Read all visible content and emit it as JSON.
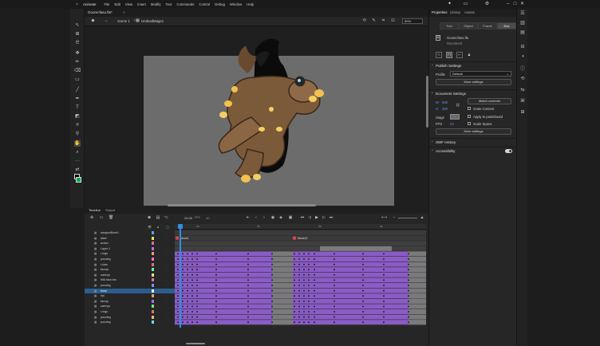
{
  "app": {
    "name": "Animate",
    "menus": [
      "File",
      "Edit",
      "View",
      "Insert",
      "Modify",
      "Text",
      "Commands",
      "Control",
      "Debug",
      "Window",
      "Help"
    ]
  },
  "document": {
    "tab_title": "Goomcfaso.fla*",
    "scene": "Scene 1",
    "symbol": "UndeadMage1",
    "zoom": "50%"
  },
  "properties": {
    "tabs": [
      "Properties",
      "Library",
      "Assets"
    ],
    "mode_tabs": [
      "Tool",
      "Object",
      "Frame",
      "Doc"
    ],
    "active_mode": "Doc",
    "doc_name": "Goomcfaso.fla",
    "doc_type": "Document",
    "publish_settings": {
      "title": "Publish Settings",
      "profile_label": "Profile",
      "profile_value": "Default",
      "more_label": "More settings"
    },
    "document_settings": {
      "title": "Document Settings",
      "w_label": "W",
      "w_value": "550",
      "h_label": "H",
      "h_value": "400",
      "match_label": "Match contents",
      "scale_content": "Scale Content",
      "apply_pasteboard": "Apply to pasteboard",
      "stage_label": "Stage",
      "fps_label": "FPS",
      "fps_value": "24",
      "scale_spans": "Scale Spans",
      "more_label": "More settings"
    },
    "swf_history": "SWF History",
    "accessibility": "Accessibility"
  },
  "timeline": {
    "tabs": [
      "Timeline",
      "Output"
    ],
    "fps": "24.00",
    "fps_unit": "FPS",
    "frame": "40",
    "ruler_ticks": [
      "1s",
      "2s",
      "3s",
      "4s"
    ],
    "frame_labels": [
      "Move1",
      "Move12"
    ],
    "layers": [
      {
        "name": "weaponBone1",
        "color": "#5aa0e6",
        "selected": false
      },
      {
        "name": "label",
        "color": "#e1e35a",
        "selected": false
      },
      {
        "name": "action",
        "color": "#e86f8f",
        "selected": false
      },
      {
        "name": "Layer 1",
        "color": "#b06fe8",
        "selected": false
      },
      {
        "name": "r-legs",
        "color": "#e8a05a",
        "selected": false
      },
      {
        "name": "pocoleg",
        "color": "#e86fd0",
        "selected": false
      },
      {
        "name": "r-kaw",
        "color": "#e86f6f",
        "selected": false
      },
      {
        "name": "facrup",
        "color": "#6fe8c0",
        "selected": false
      },
      {
        "name": "uarrnys",
        "color": "#e8e06f",
        "selected": false
      },
      {
        "name": "Wid face-fns",
        "color": "#e86fa0",
        "selected": false
      },
      {
        "name": "pocoleg",
        "color": "#6f9ee8",
        "selected": false
      },
      {
        "name": "brow",
        "color": "#e8e8e8",
        "selected": true
      },
      {
        "name": "hpl",
        "color": "#e8a06f",
        "selected": false
      },
      {
        "name": "facrup",
        "color": "#a06fe8",
        "selected": false
      },
      {
        "name": "uarrnys",
        "color": "#6fe87a",
        "selected": false
      },
      {
        "name": "r-legs",
        "color": "#e86f6f",
        "selected": false
      },
      {
        "name": "pocoleg",
        "color": "#e8c06f",
        "selected": false
      },
      {
        "name": "pocoleg",
        "color": "#6fd8e8",
        "selected": false
      }
    ]
  },
  "colors": {
    "accent": "#2f8ee8",
    "tween": "#8a5cc6",
    "stage": "#6c6c6c",
    "stroke_swatch": "#000000",
    "fill_swatch": "#17a84b"
  }
}
